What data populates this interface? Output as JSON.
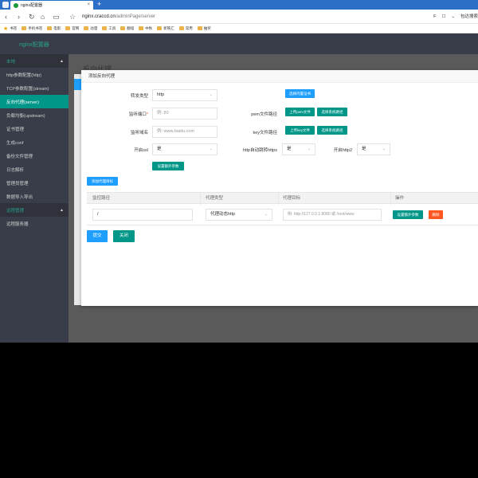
{
  "browser": {
    "tab_title": "nginx配置器",
    "tab_close": "×",
    "new_tab": "+",
    "url_host": "nginx.craccd.cn",
    "url_path": "/adminPage/server",
    "nav_back": "‹",
    "nav_forward": "›",
    "nav_reload": "↻",
    "nav_home": "⌂",
    "nav_reader": "▭",
    "bookmark_star": "☆",
    "right_items": [
      "F",
      "☐",
      "⌄",
      "包达搜索"
    ],
    "bookmarks": [
      "书签",
      "手机书签",
      "电影",
      "官网",
      "动漫",
      "工具",
      "翻墙",
      "中秋",
      "新铁汇",
      "常用",
      "抽奖"
    ]
  },
  "app": {
    "logo": "nginx配置器"
  },
  "sidebar": {
    "group1": "本地",
    "group2": "远程管理",
    "caret": "▲",
    "items": [
      {
        "label": "http参数配置(http)",
        "active": false
      },
      {
        "label": "TCP参数配置(stream)",
        "active": false
      },
      {
        "label": "反向代理(server)",
        "active": true
      },
      {
        "label": "负载均衡(upstream)",
        "active": false
      },
      {
        "label": "证书管理",
        "active": false
      },
      {
        "label": "生成conf",
        "active": false
      },
      {
        "label": "备份文件管理",
        "active": false
      },
      {
        "label": "日志解析",
        "active": false
      },
      {
        "label": "管理员管理",
        "active": false
      },
      {
        "label": "数据导入导出",
        "active": false
      }
    ],
    "remote_items": [
      {
        "label": "远程服务器"
      }
    ]
  },
  "page": {
    "title": "反向代理"
  },
  "dialog": {
    "title": "添加反向代理",
    "forward_type_label": "转发类型",
    "forward_type_value": "http",
    "listen_port_label": "监听端口",
    "listen_port_required": "*",
    "listen_port_placeholder": "例: 80",
    "domain_label": "监听域名",
    "domain_placeholder": "例: www.baidu.com",
    "ssl_label": "开启ssl",
    "ssl_value": "是",
    "select_cert_btn": "选择内置证书",
    "pem_label": "pem文件路径",
    "upload_pem_btn": "上传pem文件",
    "select_pem_btn": "选择系统路径",
    "key_label": "key文件路径",
    "upload_key_btn": "上传key文件",
    "select_key_btn": "选择系统路径",
    "https_redirect_label": "http自动跳转https",
    "https_redirect_value": "是",
    "http2_label": "开启http2",
    "http2_value": "是",
    "extra_params_btn": "设置额外参数",
    "add_target_btn": "添加代理目标",
    "table": {
      "headers": [
        "监控路径",
        "代理类型",
        "代理目标",
        "操作"
      ],
      "row": {
        "path": "/",
        "type": "代理动态http",
        "target_placeholder": "例: http://127.0.0.1:8080 或 /root/www",
        "params_btn": "设置额外参数",
        "delete_btn": "删除"
      }
    },
    "submit_btn": "提交",
    "close_btn": "关闭"
  },
  "colors": {
    "sidebar_bg": "#393d49",
    "accent_green": "#009688",
    "accent_blue": "#1e9fff",
    "danger": "#ff5722"
  }
}
